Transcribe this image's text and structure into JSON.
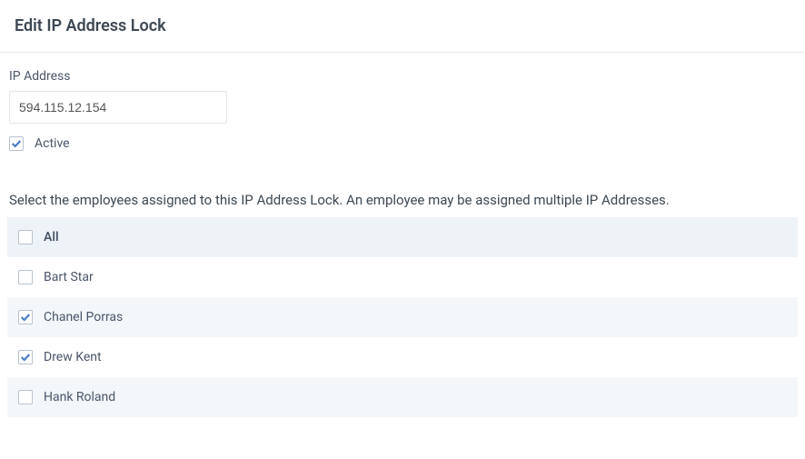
{
  "header": {
    "title": "Edit IP Address Lock"
  },
  "form": {
    "ip_label": "IP Address",
    "ip_value": "594.115.12.154",
    "active_label": "Active",
    "active_checked": true
  },
  "instruction": "Select the employees assigned to this IP Address Lock. An employee may be assigned multiple IP Addresses.",
  "employees": {
    "all_label": "All",
    "all_checked": false,
    "items": [
      {
        "name": "Bart Star",
        "checked": false
      },
      {
        "name": "Chanel Porras",
        "checked": true
      },
      {
        "name": "Drew Kent",
        "checked": true
      },
      {
        "name": "Hank Roland",
        "checked": false
      }
    ]
  }
}
